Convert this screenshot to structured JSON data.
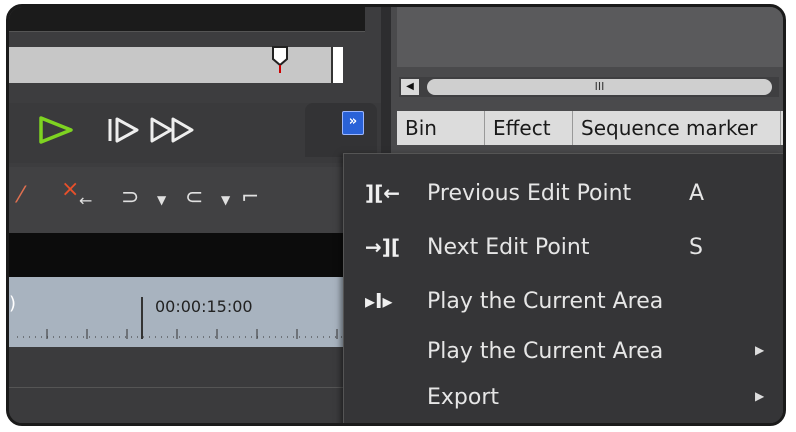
{
  "player": {
    "controls": [
      {
        "name": "play-icon",
        "glyph": "▷",
        "color": "#7ed321"
      },
      {
        "name": "step-forward-icon",
        "glyph": "I▷"
      },
      {
        "name": "fast-forward-icon",
        "glyph": "▷▷"
      }
    ],
    "more_button": "»"
  },
  "right_panel": {
    "scroll_left": "◀",
    "scroll_thumb": "III",
    "tabs": [
      "Bin",
      "Effect",
      "Sequence marker"
    ]
  },
  "timeline": {
    "timecode": "00:00:15:00"
  },
  "context_menu": {
    "items": [
      {
        "icon": "previous-edit-point-icon",
        "glyph": "][←",
        "label": "Previous Edit Point",
        "shortcut": "A",
        "submenu": false
      },
      {
        "icon": "next-edit-point-icon",
        "glyph": "→][",
        "label": "Next Edit Point",
        "shortcut": "S",
        "submenu": false
      },
      {
        "icon": "play-current-area-icon",
        "glyph": "▸I▸",
        "label": "Play the Current Area",
        "shortcut": "",
        "submenu": false
      },
      {
        "icon": "",
        "glyph": "",
        "label": "Play the Current Area",
        "shortcut": "",
        "submenu": true
      },
      {
        "icon": "",
        "glyph": "",
        "label": "Export",
        "shortcut": "",
        "submenu": true
      }
    ]
  },
  "colors": {
    "accent": "#2a62d8",
    "play": "#7ed321",
    "timeline": "#a8b3bf"
  }
}
